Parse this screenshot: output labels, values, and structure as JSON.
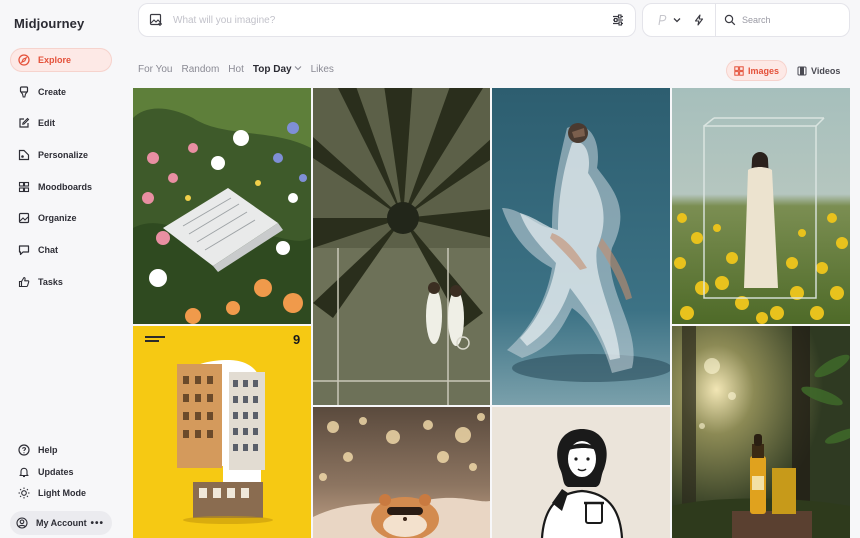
{
  "app": {
    "brand": "Midjourney"
  },
  "sidebar": {
    "nav": [
      {
        "label": "Explore",
        "icon": "compass-icon",
        "active": true
      },
      {
        "label": "Create",
        "icon": "brush-icon"
      },
      {
        "label": "Edit",
        "icon": "edit-icon"
      },
      {
        "label": "Personalize",
        "icon": "personalize-icon"
      },
      {
        "label": "Moodboards",
        "icon": "moodboards-icon"
      },
      {
        "label": "Organize",
        "icon": "organize-icon"
      },
      {
        "label": "Chat",
        "icon": "chat-icon"
      },
      {
        "label": "Tasks",
        "icon": "thumbs-up-icon"
      }
    ],
    "bottom": [
      {
        "label": "Help",
        "icon": "help-icon"
      },
      {
        "label": "Updates",
        "icon": "bell-icon"
      },
      {
        "label": "Light Mode",
        "icon": "sun-icon"
      }
    ],
    "account": {
      "label": "My Account",
      "more": "•••"
    }
  },
  "topbar": {
    "prompt_placeholder": "What will you imagine?",
    "search_placeholder": "Search"
  },
  "filters": {
    "items": [
      "For You",
      "Random",
      "Hot",
      "Top Day",
      "Likes"
    ],
    "selected": "Top Day",
    "dropdown_chevron": "⌄"
  },
  "media_tabs": {
    "images": "Images",
    "videos": "Videos",
    "active": "Images"
  },
  "gallery": {
    "poster_number": "9",
    "tiles": [
      "garden-flowers-newspaper",
      "palm-shadow-tennis-court",
      "motion-blur-dancer",
      "woman-glass-box-yellow-flowers",
      "yellow-poster-number-9-buildings",
      "bokeh-hamster",
      "line-art-girl-coffee-phone",
      "forest-serum-bottle"
    ]
  },
  "colors": {
    "accent": "#e4513a",
    "accent_bg": "#fde9e6",
    "background": "#f7f7f9"
  }
}
